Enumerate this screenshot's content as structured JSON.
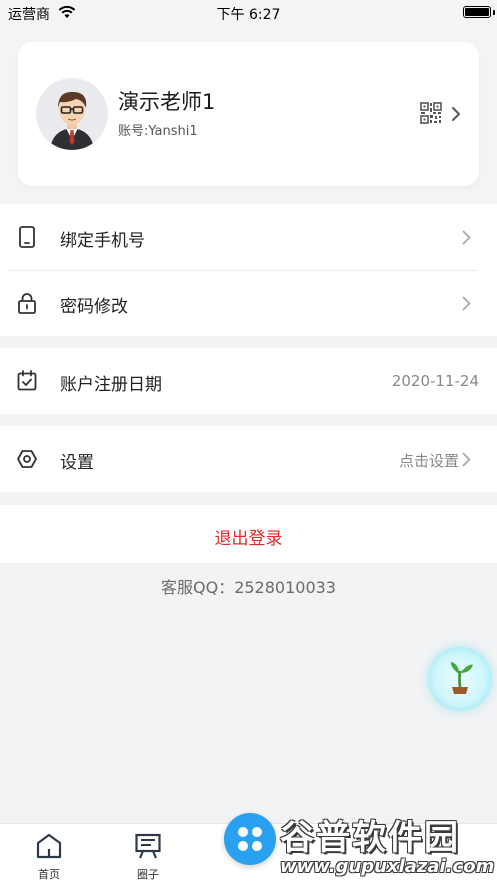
{
  "status_bar": {
    "carrier": "运营商",
    "time": "下午 6:27"
  },
  "profile": {
    "name": "演示老师1",
    "account": "账号:Yanshi1",
    "qr_icon": "qr-code-icon",
    "chevron_icon": "chevron-right-icon"
  },
  "menu_group_1": {
    "items": [
      {
        "label": "绑定手机号",
        "icon": "phone-icon"
      },
      {
        "label": "密码修改",
        "icon": "lock-icon"
      }
    ]
  },
  "register": {
    "label": "账户注册日期",
    "value": "2020-11-24",
    "icon": "calendar-check-icon"
  },
  "settings": {
    "label": "设置",
    "value": "点击设置",
    "icon": "hexagon-settings-icon"
  },
  "logout": {
    "label": "退出登录"
  },
  "service": {
    "text": "客服QQ：2528010033"
  },
  "tab_bar": {
    "tabs": [
      {
        "label": "首页",
        "icon": "home-icon"
      },
      {
        "label": "圈子",
        "icon": "board-icon"
      }
    ]
  },
  "watermark": {
    "title": "谷普软件园",
    "url": "www.gupuxlazai.com"
  },
  "colors": {
    "accent_red": "#e22a2a",
    "center_button_blue": "#2aa0f0",
    "background": "#f2f3f5"
  }
}
